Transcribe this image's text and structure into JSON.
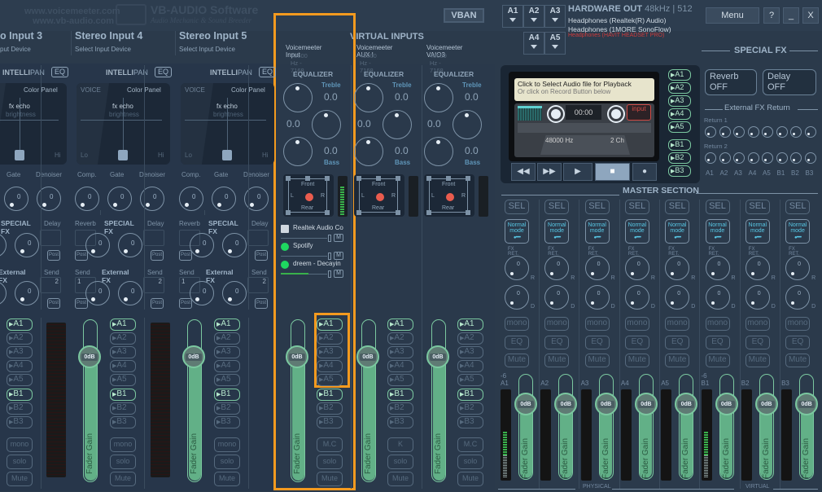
{
  "branding": {
    "url1": "www.voicemeeter.com",
    "url2": "www.vb-audio.com",
    "company": "VB-AUDIO Software",
    "tagline": "Audio Mechanic & Sound Breeder"
  },
  "vban_label": "VBAN",
  "virtual_inputs_title": "VIRTUAL INPUTS",
  "hardware_strips": [
    {
      "title": "o Input 3",
      "subtitle": "put Device"
    },
    {
      "title": "Stereo Input 4",
      "subtitle": "Select Input Device"
    },
    {
      "title": "Stereo Input 5",
      "subtitle": "Select Input Device"
    }
  ],
  "strip_common": {
    "intellipan_bold": "INTELLI",
    "intellipan_light": "PAN",
    "eq_label": "EQ",
    "color_panel": "Color Panel",
    "voice": "VOICE",
    "fx_echo": "fx echo",
    "brightness": "brightness",
    "lo": "Lo",
    "hi": "Hi",
    "comp": "Comp.",
    "gate": "Gate",
    "denoiser": "Denoiser",
    "knob_value": "0",
    "reverb": "Reverb",
    "special_fx": "SPECIAL FX",
    "delay": "Delay",
    "external_fx": "External FX",
    "send": "Send",
    "send1": "1",
    "send2": "2",
    "post": "Post",
    "fader_value": "0dB",
    "fader_label": "Fader Gain",
    "mono": "mono",
    "solo": "solo",
    "mute": "Mute"
  },
  "buses_a": [
    "A1",
    "A2",
    "A3",
    "A4",
    "A5"
  ],
  "buses_b": [
    "B1",
    "B2",
    "B3"
  ],
  "virtual_strips": [
    {
      "name": "Voicemeeter Input",
      "rate": "48000 Hz - 7168",
      "mc": "M.C"
    },
    {
      "name": "Voicemeeter AUX I",
      "rate": "48000 Hz - 7168",
      "mc": "K"
    },
    {
      "name": "Voicemeeter VAIO3",
      "rate": "48000 Hz - 7168",
      "mc": "M.C"
    }
  ],
  "eq": {
    "header": "EQUALIZER",
    "treble": "Treble",
    "bass": "Bass",
    "treble_value": "0.0",
    "mid_value": "0.0",
    "bass_value": "0.0"
  },
  "pan": {
    "front": "Front",
    "rear": "Rear",
    "l": "L",
    "r": "R"
  },
  "apps": [
    {
      "name": "Realtek Audio Co",
      "icon": "realtek-icon",
      "level": 0
    },
    {
      "name": "Spotify",
      "icon": "spotify-icon",
      "level": 0
    },
    {
      "name": "dreem - Decayin",
      "icon": "spotify-icon",
      "level": 0.6
    }
  ],
  "app_mute": "M",
  "hardware_out": {
    "title": "HARDWARE OUT",
    "info": "48kHz | 512",
    "buttons_row1": [
      "A1",
      "A2",
      "A3"
    ],
    "buttons_row2": [
      "A4",
      "A5"
    ],
    "devices": [
      {
        "name": "Headphones (Realtek(R) Audio)",
        "status": "ok"
      },
      {
        "name": "Headphones (1MORE SonoFlow)",
        "status": "ok"
      },
      {
        "name": "Headphones (HAVIT HEADSET PRO)",
        "status": "error"
      }
    ]
  },
  "window": {
    "menu": "Menu",
    "help": "?",
    "minimize": "_",
    "close": "X"
  },
  "recorder": {
    "line1": "Click to Select Audio file for Playback",
    "line2": "Or click on Record Button below",
    "time": "00:00",
    "input": "input",
    "rate": "48000 Hz",
    "channels": "2 Ch",
    "transport": [
      "rewind",
      "fast-forward",
      "play",
      "stop",
      "record"
    ],
    "buses": [
      "A1",
      "A2",
      "A3",
      "A4",
      "A5",
      "B1",
      "B2",
      "B3"
    ]
  },
  "special_fx": {
    "title": "SPECIAL FX",
    "reverb_label": "Reverb",
    "reverb_state": "OFF",
    "delay_label": "Delay",
    "delay_state": "OFF",
    "ext_return_title": "External FX Return",
    "return1": "Return 1",
    "return2": "Return 2",
    "bus_labels": [
      "A1",
      "A2",
      "A3",
      "A4",
      "A5",
      "B1",
      "B2",
      "B3"
    ]
  },
  "master": {
    "title": "MASTER SECTION",
    "sel": "SEL",
    "mode_line1": "Normal",
    "mode_line2": "mode",
    "fx_ret": "FX RET.",
    "knob_value": "0",
    "r": "R",
    "d": "D",
    "mono": "mono",
    "eq": "EQ",
    "mute": "Mute",
    "fader_value": "0dB",
    "fader_label": "Fader Gain",
    "db_marker": "-6",
    "physical": "PHYSICAL",
    "virtual": "VIRTUAL",
    "strips": [
      {
        "label": "A1",
        "level": 0.55
      },
      {
        "label": "A2",
        "level": 0
      },
      {
        "label": "A3",
        "level": 0
      },
      {
        "label": "A4",
        "level": 0
      },
      {
        "label": "A5",
        "level": 0
      },
      {
        "label": "B1",
        "level": 0.55
      },
      {
        "label": "B2",
        "level": 0
      },
      {
        "label": "B3",
        "level": 0
      }
    ]
  }
}
